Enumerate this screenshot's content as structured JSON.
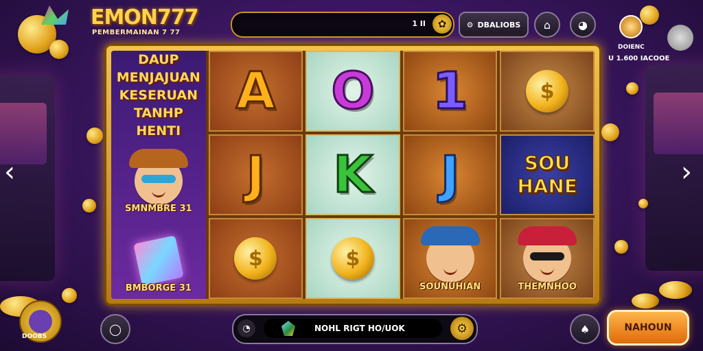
{
  "header": {
    "logo_title": "EMON777",
    "logo_subtitle": "PEMBERMAINAN 7 77",
    "balance_value": "1 II",
    "menu_button_label": "DBALIOBS",
    "user_label": "DOIENC",
    "user_value": "U 1.600 IACOOE"
  },
  "reels": {
    "promo_text": "DAUP MENJAJUAN KESERUAN TANHP HENTI",
    "promo_char_label": "SMNMBRE 31",
    "promo_box_label": "BMBORGE 31",
    "letters": {
      "a": "A",
      "o": "O",
      "one": "1",
      "j1": "J",
      "k": "K",
      "j2": "J"
    },
    "wild_text": "SOU HANE",
    "char1_label": "SOUNUHIAN",
    "char2_label": "THEMNHOO"
  },
  "bottom": {
    "left_badge_label": "DOOBS",
    "spin_text": "NOHL RIGT HO/UOK",
    "main_button_label": "NAHOUN"
  },
  "colors": {
    "gold": "#ffd34d",
    "purple_bg": "#3a1660",
    "orange_button": "#e06a0a"
  },
  "icons": {
    "nav_left": "chevron-left-icon",
    "nav_right": "chevron-right-icon",
    "gear": "gear-icon",
    "chat": "chat-icon",
    "home": "home-icon"
  }
}
